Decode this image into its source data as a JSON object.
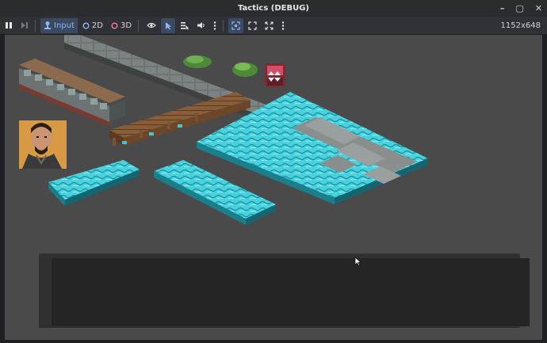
{
  "window": {
    "title": "Tactics (DEBUG)",
    "controls": [
      "–",
      "▢",
      "✕"
    ]
  },
  "toolbar": {
    "pause_icon": "pause-icon",
    "step_icon": "step-icon",
    "input_label": "Input",
    "mode_2d_label": "2D",
    "mode_3d_label": "3D",
    "resolution": "1152x648"
  },
  "colors": {
    "viewport_bg": "#4a4a4a",
    "water": "#3ec9d6",
    "water_dark": "#1a7f8c",
    "stone": "#6c7272",
    "wood": "#7a5334"
  }
}
